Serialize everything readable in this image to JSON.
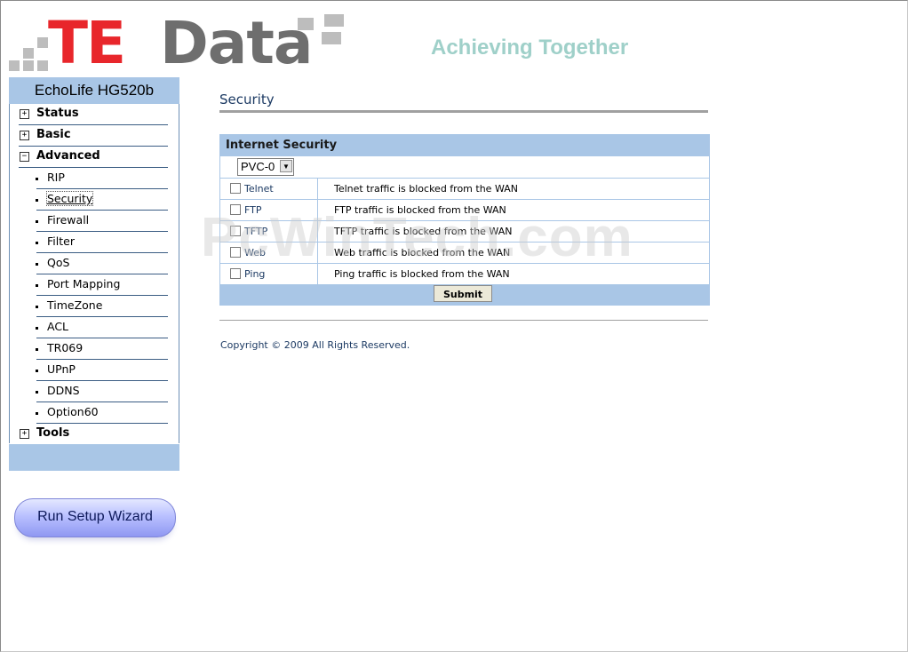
{
  "brand": {
    "logo_part1": "TE",
    "logo_part2": "Data",
    "tagline": "Achieving Together",
    "colors": {
      "te_red": "#e8262b",
      "data_gray": "#6e6e6e",
      "tagline": "#9fd0c9",
      "accent": "#a9c6e6"
    }
  },
  "sidebar": {
    "device": "EchoLife HG520b",
    "items": [
      {
        "label": "Status",
        "expanded": false
      },
      {
        "label": "Basic",
        "expanded": false
      },
      {
        "label": "Advanced",
        "expanded": true
      },
      {
        "label": "RIP"
      },
      {
        "label": "Security",
        "active": true
      },
      {
        "label": "Firewall"
      },
      {
        "label": "Filter"
      },
      {
        "label": "QoS"
      },
      {
        "label": "Port Mapping"
      },
      {
        "label": "TimeZone"
      },
      {
        "label": "ACL"
      },
      {
        "label": "TR069"
      },
      {
        "label": "UPnP"
      },
      {
        "label": "DDNS"
      },
      {
        "label": "Option60"
      },
      {
        "label": "Tools",
        "expanded": false
      }
    ],
    "wizard_label": "Run Setup Wizard",
    "plus_glyph": "+",
    "minus_glyph": "−"
  },
  "main": {
    "title": "Security",
    "panel_title": "Internet Security",
    "pvc_selected": "PVC-0",
    "rows": [
      {
        "name": "Telnet",
        "desc": "Telnet traffic is blocked from the WAN",
        "checked": false
      },
      {
        "name": "FTP",
        "desc": "FTP traffic is blocked from the WAN",
        "checked": false
      },
      {
        "name": "TFTP",
        "desc": "TFTP traffic is blocked from the WAN",
        "checked": false
      },
      {
        "name": "Web",
        "desc": "Web traffic is blocked from the WAN",
        "checked": false
      },
      {
        "name": "Ping",
        "desc": "Ping traffic is blocked from the WAN",
        "checked": false
      }
    ],
    "submit_label": "Submit",
    "copyright": "Copyright © 2009 All Rights Reserved."
  },
  "watermark": "PcWinTech.com"
}
